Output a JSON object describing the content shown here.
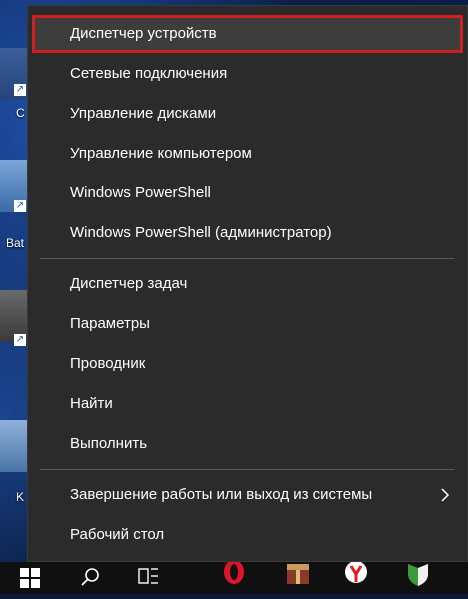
{
  "desktop": {
    "icon_labels": [
      "C",
      "Bat",
      "K"
    ]
  },
  "menu": {
    "group1": [
      {
        "label": "Диспетчер устройств",
        "highlighted": true
      },
      {
        "label": "Сетевые подключения"
      },
      {
        "label": "Управление дисками"
      },
      {
        "label": "Управление компьютером"
      },
      {
        "label": "Windows PowerShell"
      },
      {
        "label": "Windows PowerShell (администратор)"
      }
    ],
    "group2": [
      {
        "label": "Диспетчер задач"
      },
      {
        "label": "Параметры"
      },
      {
        "label": "Проводник"
      },
      {
        "label": "Найти"
      },
      {
        "label": "Выполнить"
      }
    ],
    "group3": [
      {
        "label": "Завершение работы или выход из системы",
        "has_submenu": true
      },
      {
        "label": "Рабочий стол"
      }
    ]
  },
  "colors": {
    "menu_bg": "#2b2b2b",
    "highlight_border": "#d21e1e",
    "text": "#ffffff"
  },
  "taskbar": {
    "icons": [
      "windows-start-icon",
      "search-icon",
      "task-view-icon",
      "opera-icon",
      "archive-app-icon",
      "yandex-browser-icon",
      "green-shield-app-icon"
    ]
  }
}
